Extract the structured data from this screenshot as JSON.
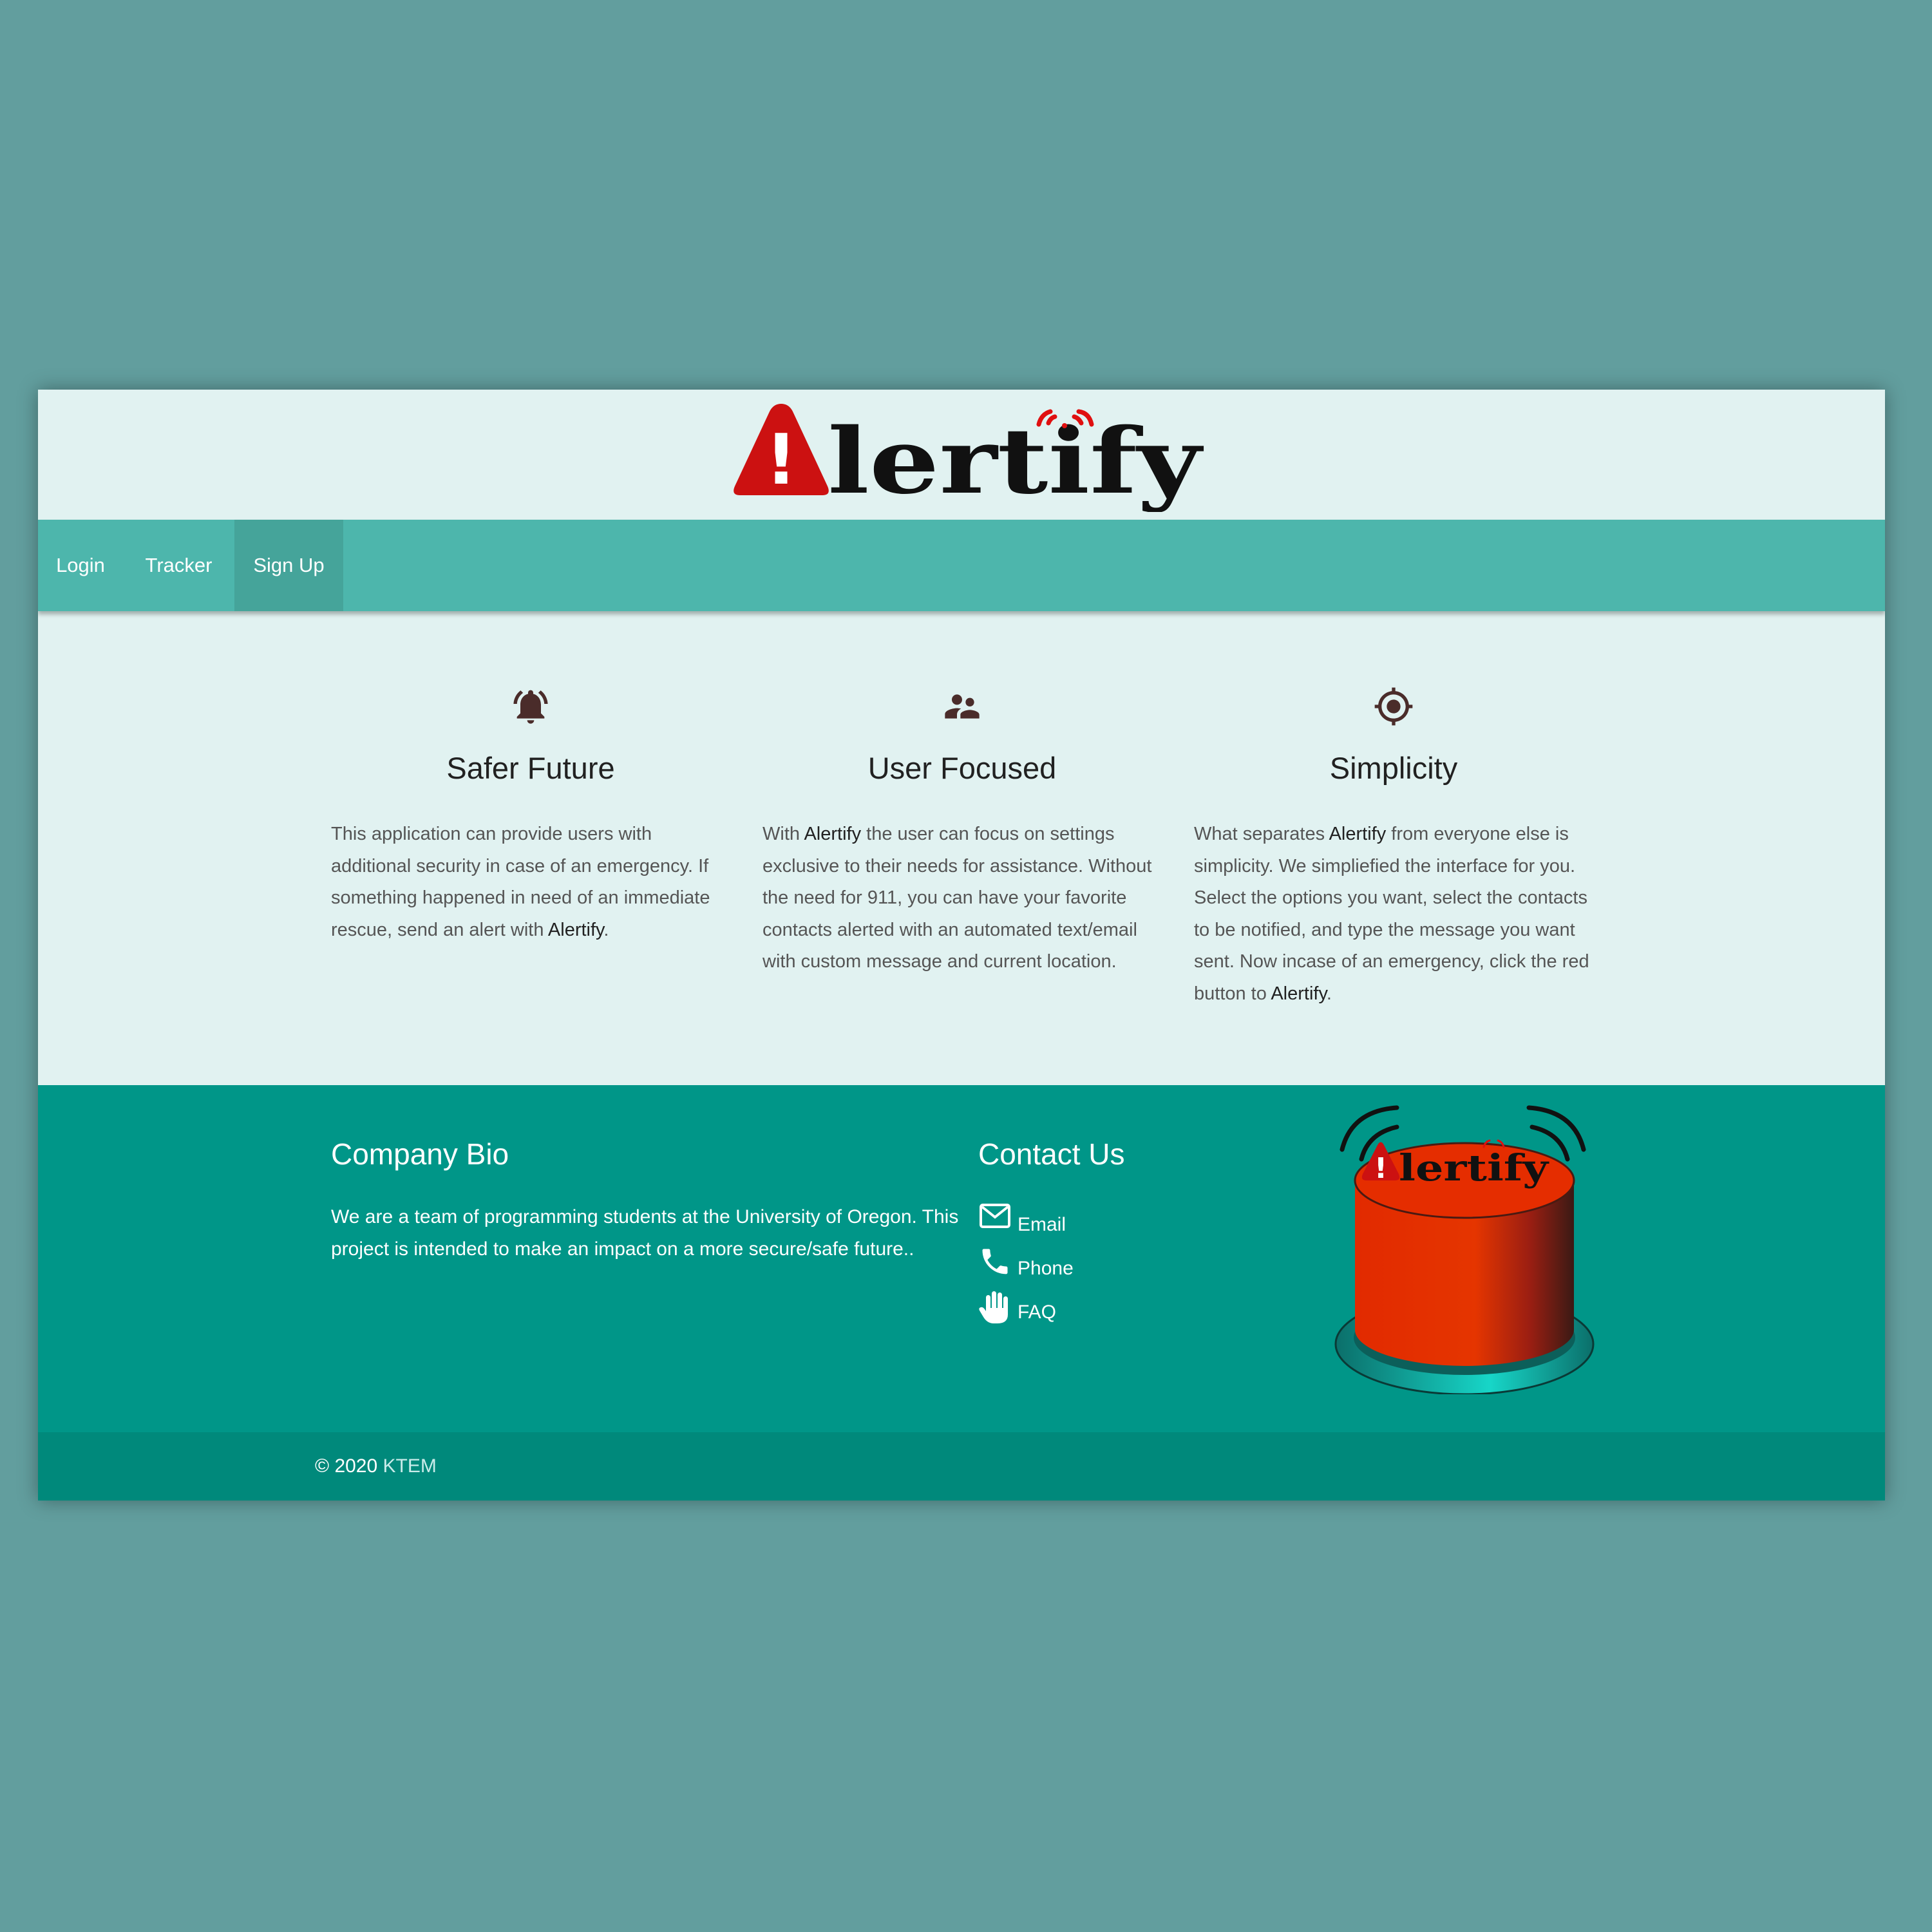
{
  "brand": {
    "logo_letter": "!",
    "logo_text": "lertify"
  },
  "nav": {
    "items": [
      {
        "label": "Login",
        "active": false
      },
      {
        "label": "Tracker",
        "active": false
      },
      {
        "label": "Sign Up",
        "active": true
      }
    ]
  },
  "features": [
    {
      "icon": "bell-icon",
      "title": "Safer Future",
      "text_parts": [
        "This application can provide users with additional security in case of an emergency. If something happened in need of an immediate rescue, send an alert with ",
        "Alertify",
        "."
      ]
    },
    {
      "icon": "people-icon",
      "title": "User Focused",
      "text_parts": [
        "With ",
        "Alertify",
        " the user can focus on settings exclusive to their needs for assistance. Without the need for 911, you can have your favorite contacts alerted with an automated text/email with custom message and current location."
      ]
    },
    {
      "icon": "location-target-icon",
      "title": "Simplicity",
      "text_parts": [
        "What separates ",
        "Alertify",
        " from everyone else is simplicity. We simpliefied the interface for you. Select the options you want, select the contacts to be notified, and type the message you want sent. Now incase of an emergency, click the red button to ",
        "Alertify",
        "."
      ]
    }
  ],
  "footer": {
    "bio_title": "Company Bio",
    "bio_text": "We are a team of programming students at the University of Oregon. This project is intended to make an impact on a more secure/safe future..",
    "contact_title": "Contact Us",
    "contacts": [
      {
        "icon": "mail-icon",
        "label": "Email"
      },
      {
        "icon": "phone-icon",
        "label": "Phone"
      },
      {
        "icon": "hand-icon",
        "label": "FAQ"
      }
    ],
    "button_logo_letter": "!",
    "button_logo_text": "lertify"
  },
  "copyright": {
    "prefix": "© 2020 ",
    "brand": "KTEM"
  },
  "colors": {
    "outer_background": "#629e9e",
    "page_background": "#e1f2f1",
    "navbar": "#4db6ac",
    "nav_active": "#45a49a",
    "footer": "#009688",
    "copyright_bar": "#00897b",
    "alert_red": "#cc1111",
    "icon_brown": "#4a2c2a"
  }
}
